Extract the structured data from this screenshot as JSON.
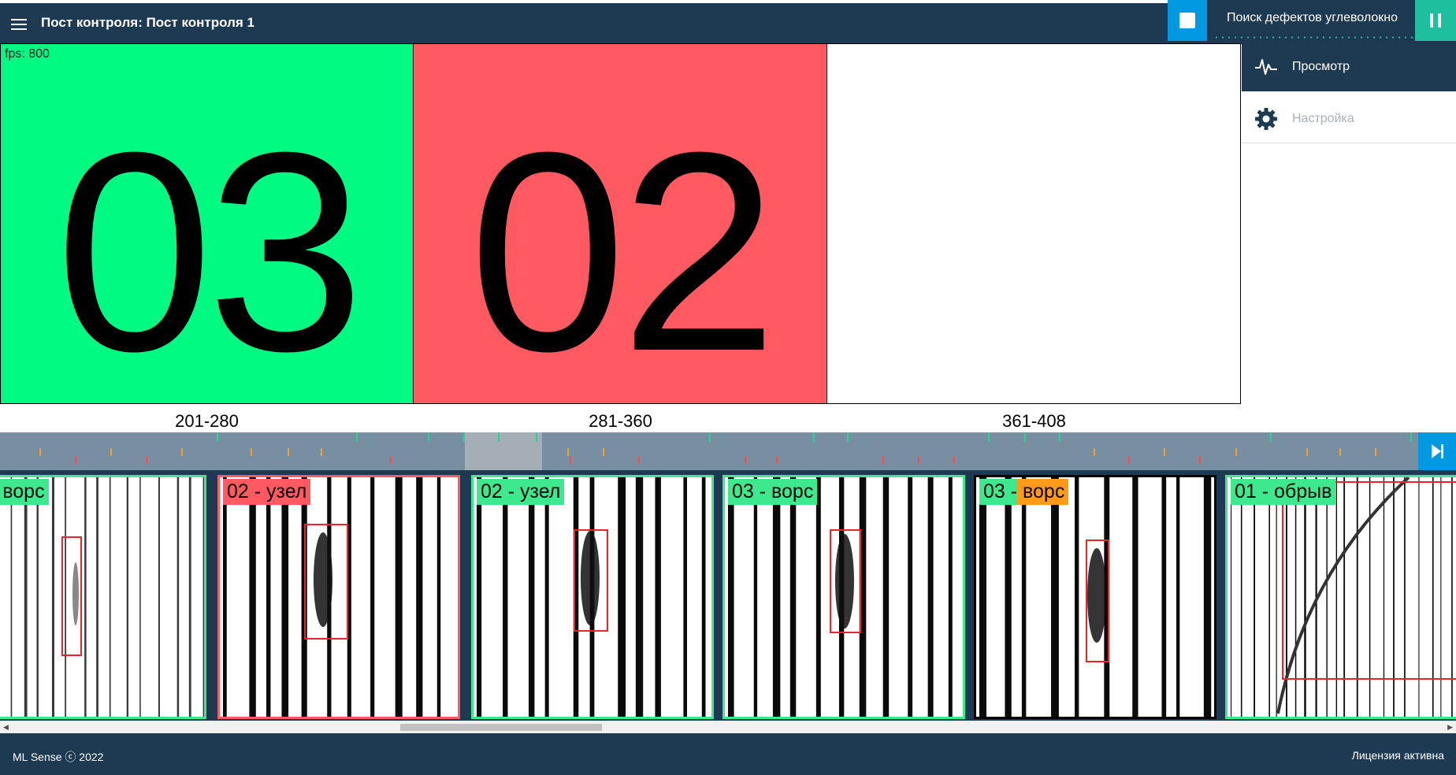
{
  "header": {
    "title": "Пост контроля: Пост контроля 1",
    "mode_label": "Поиск дефектов углеволокно"
  },
  "tiles": [
    {
      "number": "03",
      "range": "201-280",
      "color": "#00fa82"
    },
    {
      "number": "02",
      "range": "281-360",
      "color": "#ff5a62"
    },
    {
      "number": "",
      "range": "361-408",
      "color": "#ffffff"
    }
  ],
  "fps_label": "fps: 800",
  "sidebar": {
    "items": [
      {
        "label": "Просмотр",
        "icon": "pulse-icon",
        "active": true
      },
      {
        "label": "Настройка",
        "icon": "gear-icon",
        "active": false
      }
    ]
  },
  "frames": [
    {
      "label": "- ворс",
      "status_color": "#3ee88c",
      "label_bg": "#3ee88c"
    },
    {
      "label": "02 - узел",
      "status_color": "#ff5a62",
      "label_bg": "#ff5a62"
    },
    {
      "label": "02 - узел",
      "status_color": "#3ee88c",
      "label_bg": "#3ee88c"
    },
    {
      "label": "03 - ворс",
      "status_color": "#3ee88c",
      "label_bg": "#3ee88c"
    },
    {
      "label": "03 - ворс",
      "status_color": "#000000",
      "label_bg": "#ff9a1a"
    },
    {
      "label": "01 - обрыв",
      "status_color": "#3ee88c",
      "label_bg": "#3ee88c"
    }
  ],
  "footer": {
    "copyright": "ML Sense ⓒ 2022",
    "license": "Лицензия активна"
  },
  "colors": {
    "navy": "#1e3a52",
    "accent_blue": "#0098e0",
    "accent_teal": "#1ebf9f",
    "timeline": "#778fa1"
  }
}
